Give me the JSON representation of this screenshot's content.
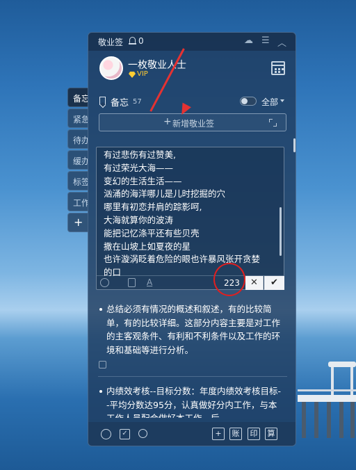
{
  "side_tabs": [
    "备忘",
    "紧急",
    "待办",
    "缓办",
    "标签",
    "工作",
    "+"
  ],
  "titlebar": {
    "title": "敬业签",
    "notification_count": "0"
  },
  "profile": {
    "username": "一枚敬业人士",
    "badge": "VIP"
  },
  "memo_section": {
    "label": "备忘",
    "count": "57",
    "filter_label": "全部"
  },
  "add_button": {
    "label": "新增敬业签"
  },
  "editor": {
    "text": "有过悲伤有过赞美,\n有过荣光大海——\n变幻的生活生活——\n汹涌的海洋哪儿是儿时挖掘的穴\n哪里有初恋并肩的踪影呵,\n大海就算你的波涛\n能把记忆涤平还有些贝壳\n撒在山坡上如夏夜的星\n也许漩涡眨着危险的眼也许暴风张开贪婪\n的口",
    "char_count": "223",
    "cancel_label": "✕",
    "confirm_label": "✔"
  },
  "notes": [
    {
      "text": "总结必须有情况的概述和叙述，有的比较简单，有的比较详细。这部分内容主要是对工作的主客观条件、有利和不利条件以及工作的环境和基础等进行分析。"
    },
    {
      "text": "内绩效考核--目标分数：年度内绩效考核目标--平均分数达95分，认真做好分内工作，与本工作人员配合做好本工作。后"
    }
  ],
  "bottom_buttons": [
    "账",
    "印",
    "算"
  ],
  "icons": {
    "bell": "bell-icon",
    "cloud": "cloud-icon",
    "menu": "menu-icon",
    "collapse": "chevron-up-icon",
    "calendar": "calendar-icon"
  },
  "colors": {
    "accent_red": "#e01f1f",
    "vip_gold": "#ffcc33"
  }
}
